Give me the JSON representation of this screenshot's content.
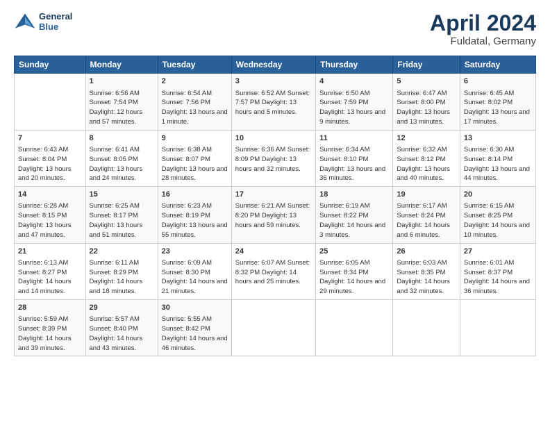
{
  "header": {
    "logo_line1": "General",
    "logo_line2": "Blue",
    "title": "April 2024",
    "subtitle": "Fuldatal, Germany"
  },
  "days_of_week": [
    "Sunday",
    "Monday",
    "Tuesday",
    "Wednesday",
    "Thursday",
    "Friday",
    "Saturday"
  ],
  "weeks": [
    [
      {
        "num": "",
        "info": ""
      },
      {
        "num": "1",
        "info": "Sunrise: 6:56 AM\nSunset: 7:54 PM\nDaylight: 12 hours\nand 57 minutes."
      },
      {
        "num": "2",
        "info": "Sunrise: 6:54 AM\nSunset: 7:56 PM\nDaylight: 13 hours\nand 1 minute."
      },
      {
        "num": "3",
        "info": "Sunrise: 6:52 AM\nSunset: 7:57 PM\nDaylight: 13 hours\nand 5 minutes."
      },
      {
        "num": "4",
        "info": "Sunrise: 6:50 AM\nSunset: 7:59 PM\nDaylight: 13 hours\nand 9 minutes."
      },
      {
        "num": "5",
        "info": "Sunrise: 6:47 AM\nSunset: 8:00 PM\nDaylight: 13 hours\nand 13 minutes."
      },
      {
        "num": "6",
        "info": "Sunrise: 6:45 AM\nSunset: 8:02 PM\nDaylight: 13 hours\nand 17 minutes."
      }
    ],
    [
      {
        "num": "7",
        "info": "Sunrise: 6:43 AM\nSunset: 8:04 PM\nDaylight: 13 hours\nand 20 minutes."
      },
      {
        "num": "8",
        "info": "Sunrise: 6:41 AM\nSunset: 8:05 PM\nDaylight: 13 hours\nand 24 minutes."
      },
      {
        "num": "9",
        "info": "Sunrise: 6:38 AM\nSunset: 8:07 PM\nDaylight: 13 hours\nand 28 minutes."
      },
      {
        "num": "10",
        "info": "Sunrise: 6:36 AM\nSunset: 8:09 PM\nDaylight: 13 hours\nand 32 minutes."
      },
      {
        "num": "11",
        "info": "Sunrise: 6:34 AM\nSunset: 8:10 PM\nDaylight: 13 hours\nand 36 minutes."
      },
      {
        "num": "12",
        "info": "Sunrise: 6:32 AM\nSunset: 8:12 PM\nDaylight: 13 hours\nand 40 minutes."
      },
      {
        "num": "13",
        "info": "Sunrise: 6:30 AM\nSunset: 8:14 PM\nDaylight: 13 hours\nand 44 minutes."
      }
    ],
    [
      {
        "num": "14",
        "info": "Sunrise: 6:28 AM\nSunset: 8:15 PM\nDaylight: 13 hours\nand 47 minutes."
      },
      {
        "num": "15",
        "info": "Sunrise: 6:25 AM\nSunset: 8:17 PM\nDaylight: 13 hours\nand 51 minutes."
      },
      {
        "num": "16",
        "info": "Sunrise: 6:23 AM\nSunset: 8:19 PM\nDaylight: 13 hours\nand 55 minutes."
      },
      {
        "num": "17",
        "info": "Sunrise: 6:21 AM\nSunset: 8:20 PM\nDaylight: 13 hours\nand 59 minutes."
      },
      {
        "num": "18",
        "info": "Sunrise: 6:19 AM\nSunset: 8:22 PM\nDaylight: 14 hours\nand 3 minutes."
      },
      {
        "num": "19",
        "info": "Sunrise: 6:17 AM\nSunset: 8:24 PM\nDaylight: 14 hours\nand 6 minutes."
      },
      {
        "num": "20",
        "info": "Sunrise: 6:15 AM\nSunset: 8:25 PM\nDaylight: 14 hours\nand 10 minutes."
      }
    ],
    [
      {
        "num": "21",
        "info": "Sunrise: 6:13 AM\nSunset: 8:27 PM\nDaylight: 14 hours\nand 14 minutes."
      },
      {
        "num": "22",
        "info": "Sunrise: 6:11 AM\nSunset: 8:29 PM\nDaylight: 14 hours\nand 18 minutes."
      },
      {
        "num": "23",
        "info": "Sunrise: 6:09 AM\nSunset: 8:30 PM\nDaylight: 14 hours\nand 21 minutes."
      },
      {
        "num": "24",
        "info": "Sunrise: 6:07 AM\nSunset: 8:32 PM\nDaylight: 14 hours\nand 25 minutes."
      },
      {
        "num": "25",
        "info": "Sunrise: 6:05 AM\nSunset: 8:34 PM\nDaylight: 14 hours\nand 29 minutes."
      },
      {
        "num": "26",
        "info": "Sunrise: 6:03 AM\nSunset: 8:35 PM\nDaylight: 14 hours\nand 32 minutes."
      },
      {
        "num": "27",
        "info": "Sunrise: 6:01 AM\nSunset: 8:37 PM\nDaylight: 14 hours\nand 36 minutes."
      }
    ],
    [
      {
        "num": "28",
        "info": "Sunrise: 5:59 AM\nSunset: 8:39 PM\nDaylight: 14 hours\nand 39 minutes."
      },
      {
        "num": "29",
        "info": "Sunrise: 5:57 AM\nSunset: 8:40 PM\nDaylight: 14 hours\nand 43 minutes."
      },
      {
        "num": "30",
        "info": "Sunrise: 5:55 AM\nSunset: 8:42 PM\nDaylight: 14 hours\nand 46 minutes."
      },
      {
        "num": "",
        "info": ""
      },
      {
        "num": "",
        "info": ""
      },
      {
        "num": "",
        "info": ""
      },
      {
        "num": "",
        "info": ""
      }
    ]
  ]
}
